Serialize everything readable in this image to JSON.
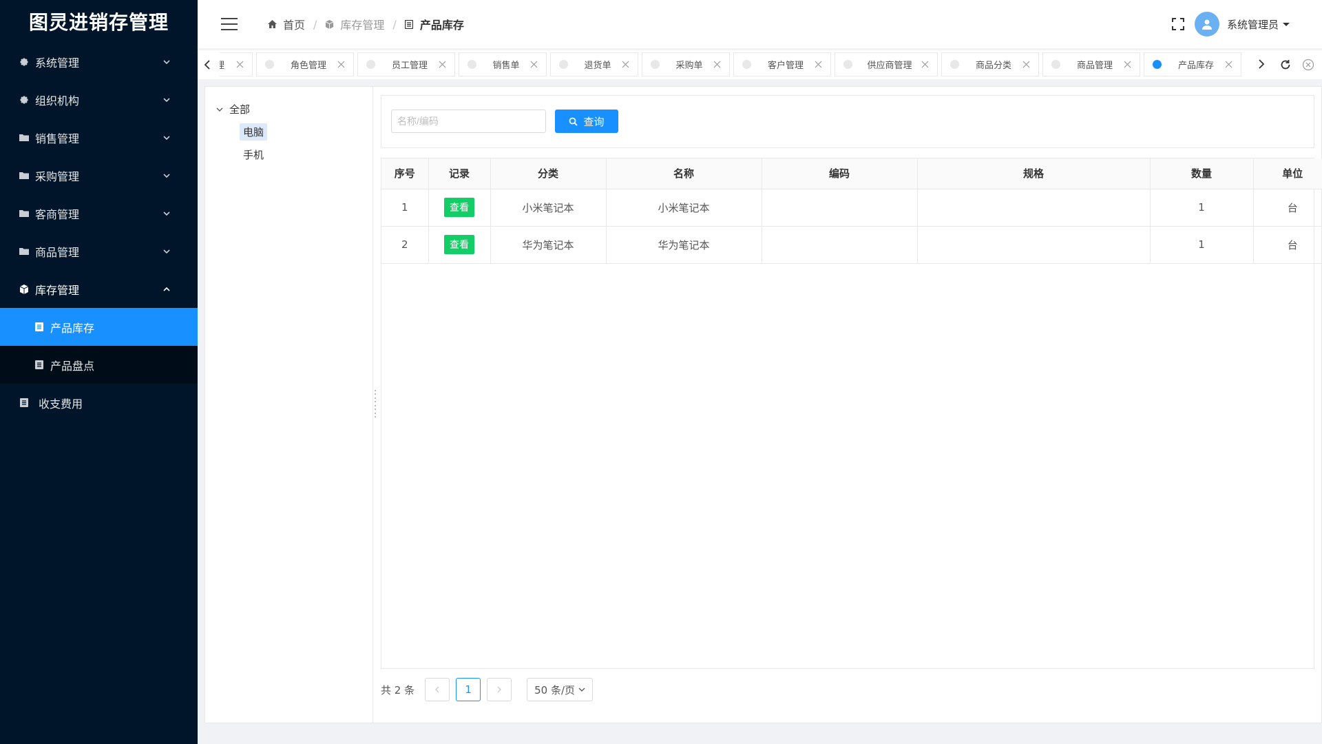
{
  "app": {
    "title": "图灵进销存管理"
  },
  "sidebar": {
    "menus": [
      {
        "label": "系统管理",
        "icon": "gear-icon"
      },
      {
        "label": "组织机构",
        "icon": "gear-icon"
      },
      {
        "label": "销售管理",
        "icon": "folder-icon"
      },
      {
        "label": "采购管理",
        "icon": "folder-icon"
      },
      {
        "label": "客商管理",
        "icon": "folder-icon"
      },
      {
        "label": "商品管理",
        "icon": "folder-icon"
      },
      {
        "label": "库存管理",
        "icon": "cube-icon"
      }
    ],
    "submenu": [
      {
        "label": "产品库存",
        "icon": "document-icon"
      },
      {
        "label": "产品盘点",
        "icon": "document-icon"
      }
    ],
    "finance": {
      "label": "收支费用",
      "icon": "document-icon"
    },
    "active_color": "#1890ff",
    "bg_color": "#001529"
  },
  "header": {
    "breadcrumb": [
      {
        "label": "首页",
        "icon": "home-icon"
      },
      {
        "label": "库存管理",
        "icon": "cube-icon"
      },
      {
        "label": "产品库存",
        "icon": "document-icon"
      }
    ],
    "user": {
      "name": "系统管理员"
    }
  },
  "tabs": [
    {
      "label": "管理"
    },
    {
      "label": "角色管理"
    },
    {
      "label": "员工管理"
    },
    {
      "label": "销售单"
    },
    {
      "label": "退货单"
    },
    {
      "label": "采购单"
    },
    {
      "label": "客户管理"
    },
    {
      "label": "供应商管理"
    },
    {
      "label": "商品分类"
    },
    {
      "label": "商品管理"
    },
    {
      "label": "产品库存"
    }
  ],
  "tree": {
    "root": "全部",
    "nodes": [
      "电脑",
      "手机"
    ],
    "selected": "电脑"
  },
  "search": {
    "placeholder": "名称/编码",
    "button_label": "查询"
  },
  "table": {
    "columns": [
      "序号",
      "记录",
      "分类",
      "名称",
      "编码",
      "规格",
      "数量",
      "单位"
    ],
    "rows": [
      {
        "index": "1",
        "action": "查看",
        "category": "小米笔记本",
        "name": "小米笔记本",
        "code": "",
        "spec": "",
        "qty": "1",
        "unit": "台"
      },
      {
        "index": "2",
        "action": "查看",
        "category": "华为笔记本",
        "name": "华为笔记本",
        "code": "",
        "spec": "",
        "qty": "1",
        "unit": "台"
      }
    ]
  },
  "pagination": {
    "total": "共 2 条",
    "current_page": "1",
    "page_size": "50 条/页"
  }
}
